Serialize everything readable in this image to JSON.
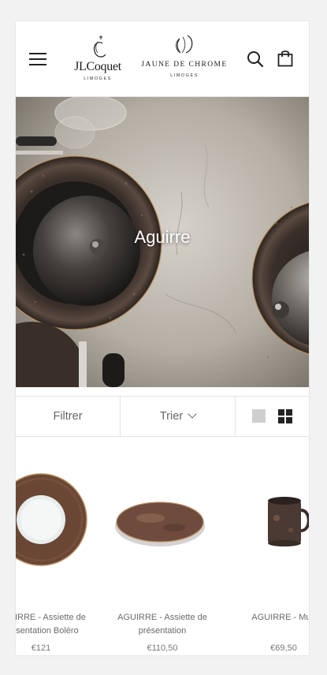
{
  "header": {
    "logo_left": {
      "name": "JLCoquet",
      "sub": "LIMOGES"
    },
    "logo_right": {
      "name": "JAUNE DE CHROME",
      "sub": "LIMOGES"
    }
  },
  "hero": {
    "title": "Aguirre"
  },
  "toolbar": {
    "filter_label": "Filtrer",
    "sort_label": "Trier"
  },
  "products": [
    {
      "title_line1": "AGUIRRE - Assiette de",
      "title_line2": "présentation Boléro",
      "price": "€121"
    },
    {
      "title_line1": "AGUIRRE - Assiette de",
      "title_line2": "présentation",
      "price": "€110,50"
    },
    {
      "title_line1": "AGUIRRE - Mug",
      "title_line2": "",
      "price": "€69,50"
    }
  ],
  "colors": {
    "accent": "#222222",
    "background": "#f2f2f2",
    "card_bg": "#ffffff",
    "bronze": "#6b4a3a"
  }
}
